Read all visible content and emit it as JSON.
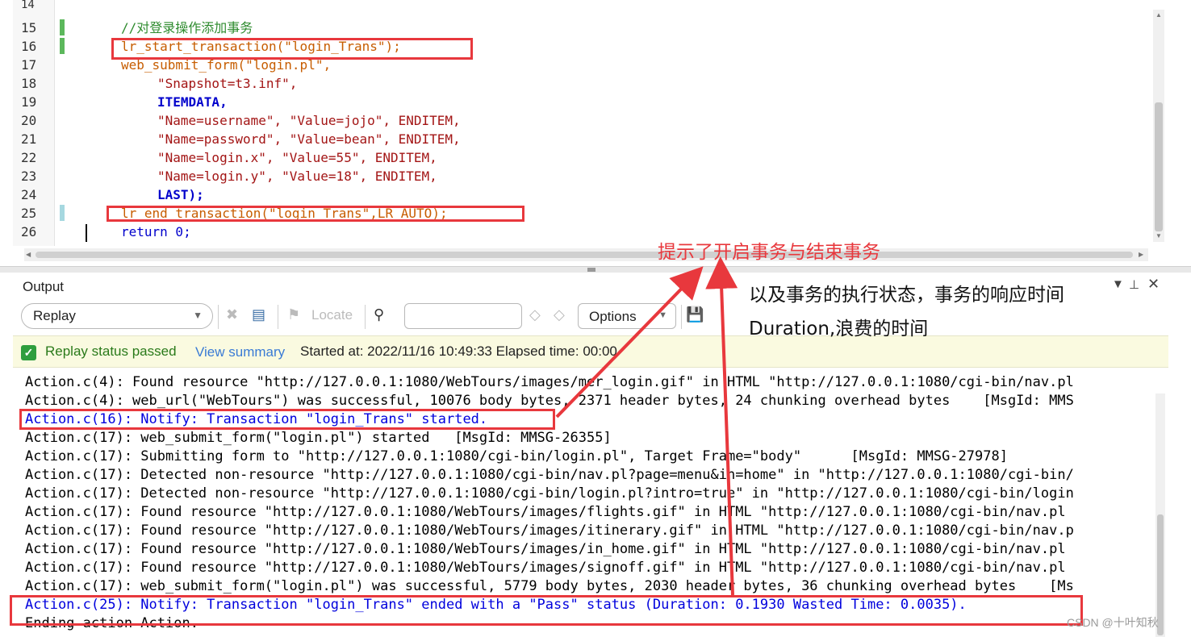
{
  "editor": {
    "partial_top_line": "14",
    "lines": [
      {
        "num": "15",
        "text": "//对登录操作添加事务"
      },
      {
        "num": "16",
        "text": "lr_start_transaction(\"login_Trans\");"
      },
      {
        "num": "17",
        "text": "web_submit_form(\"login.pl\","
      },
      {
        "num": "18",
        "text": "\"Snapshot=t3.inf\","
      },
      {
        "num": "19",
        "text": "ITEMDATA,"
      },
      {
        "num": "20",
        "text": "\"Name=username\", \"Value=jojo\", ENDITEM,"
      },
      {
        "num": "21",
        "text": "\"Name=password\", \"Value=bean\", ENDITEM,"
      },
      {
        "num": "22",
        "text": "\"Name=login.x\", \"Value=55\", ENDITEM,"
      },
      {
        "num": "23",
        "text": "\"Name=login.y\", \"Value=18\", ENDITEM,"
      },
      {
        "num": "24",
        "text": "LAST);"
      },
      {
        "num": "25",
        "text": "lr_end_transaction(\"login_Trans\",LR_AUTO);"
      },
      {
        "num": "26",
        "text": "return 0;"
      }
    ]
  },
  "output": {
    "title": "Output",
    "replay_select": "Replay",
    "locate_label": "Locate",
    "options_label": "Options",
    "search_value": "",
    "status": {
      "passed_text": "Replay status passed",
      "view_summary": "View summary",
      "started": "Started at: 2022/11/16 10:49:33 Elapsed time: 00:00"
    },
    "log_lines": [
      "Action.c(4): Found resource \"http://127.0.0.1:1080/WebTours/images/mer_login.gif\" in HTML \"http://127.0.0.1:1080/cgi-bin/nav.pl",
      "Action.c(4): web_url(\"WebTours\") was successful, 10076 body bytes, 2371 header bytes, 24 chunking overhead bytes    [MsgId: MMS",
      "Action.c(16): Notify: Transaction \"login_Trans\" started.",
      "Action.c(17): web_submit_form(\"login.pl\") started   [MsgId: MMSG-26355]",
      "Action.c(17): Submitting form to \"http://127.0.0.1:1080/cgi-bin/login.pl\", Target Frame=\"body\"      [MsgId: MMSG-27978]",
      "Action.c(17): Detected non-resource \"http://127.0.0.1:1080/cgi-bin/nav.pl?page=menu&in=home\" in \"http://127.0.0.1:1080/cgi-bin/",
      "Action.c(17): Detected non-resource \"http://127.0.0.1:1080/cgi-bin/login.pl?intro=true\" in \"http://127.0.0.1:1080/cgi-bin/login",
      "Action.c(17): Found resource \"http://127.0.0.1:1080/WebTours/images/flights.gif\" in HTML \"http://127.0.0.1:1080/cgi-bin/nav.pl",
      "Action.c(17): Found resource \"http://127.0.0.1:1080/WebTours/images/itinerary.gif\" in HTML \"http://127.0.0.1:1080/cgi-bin/nav.p",
      "Action.c(17): Found resource \"http://127.0.0.1:1080/WebTours/images/in_home.gif\" in HTML \"http://127.0.0.1:1080/cgi-bin/nav.pl",
      "Action.c(17): Found resource \"http://127.0.0.1:1080/WebTours/images/signoff.gif\" in HTML \"http://127.0.0.1:1080/cgi-bin/nav.pl",
      "Action.c(17): web_submit_form(\"login.pl\") was successful, 5779 body bytes, 2030 header bytes, 36 chunking overhead bytes    [Ms",
      "Action.c(25): Notify: Transaction \"login_Trans\" ended with a \"Pass\" status (Duration: 0.1930 Wasted Time: 0.0035).",
      "Ending action Action."
    ]
  },
  "annotations": {
    "label1": "提示了开启事务与结束事务",
    "label2_line1": "以及事务的执行状态，事务的响应时间",
    "label2_line2": "Duration,浪费的时间",
    "color": "#e8383d"
  },
  "watermark": "CSDN @十叶知秋"
}
